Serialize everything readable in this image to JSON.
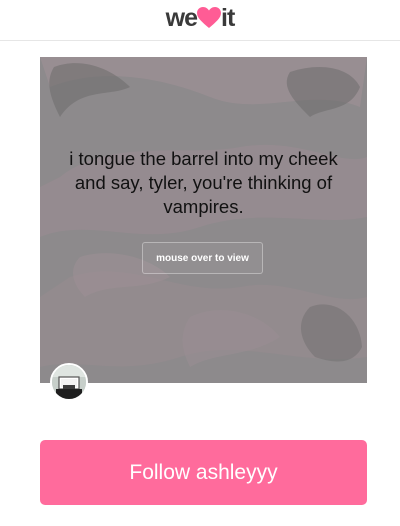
{
  "header": {
    "logo_left": "we",
    "logo_right": "it",
    "logo_icon": "heart-icon",
    "brand_color": "#ff6b9c"
  },
  "post": {
    "quote": "i tongue the barrel into my cheek and say, tyler, you're thinking of vampires.",
    "reveal_button_label": "mouse over to view"
  },
  "follow": {
    "label": "Follow ashleyyy",
    "button_color": "#ff6b9c"
  }
}
